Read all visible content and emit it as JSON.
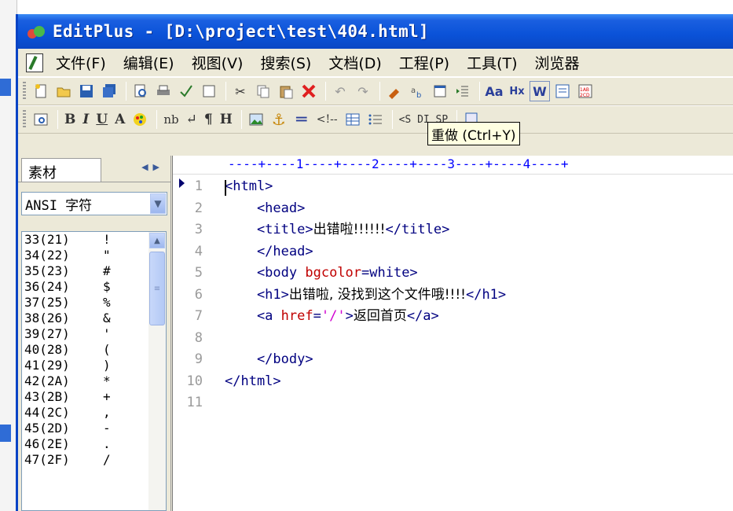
{
  "window": {
    "title": "EditPlus - [D:\\project\\test\\404.html]"
  },
  "menu": [
    "文件(F)",
    "编辑(E)",
    "视图(V)",
    "搜索(S)",
    "文档(D)",
    "工程(P)",
    "工具(T)",
    "浏览器"
  ],
  "toolbar2_text": {
    "bold": "B",
    "italic": "I",
    "underline": "U",
    "font": "A",
    "nb": "nb",
    "newline": "↵",
    "para": "¶",
    "heading": "H",
    "comment": "<!--",
    "sdisp": "<S DI SP"
  },
  "tooltip": "重做 (Ctrl+Y)",
  "left_panel": {
    "tab_label": "素材",
    "charset": "ANSI 字符",
    "chars": [
      {
        "code": "33(21)",
        "glyph": "!"
      },
      {
        "code": "34(22)",
        "glyph": "\""
      },
      {
        "code": "35(23)",
        "glyph": "#"
      },
      {
        "code": "36(24)",
        "glyph": "$"
      },
      {
        "code": "37(25)",
        "glyph": "%"
      },
      {
        "code": "38(26)",
        "glyph": "&"
      },
      {
        "code": "39(27)",
        "glyph": "'"
      },
      {
        "code": "40(28)",
        "glyph": "("
      },
      {
        "code": "41(29)",
        "glyph": ")"
      },
      {
        "code": "42(2A)",
        "glyph": "*"
      },
      {
        "code": "43(2B)",
        "glyph": "+"
      },
      {
        "code": "44(2C)",
        "glyph": ","
      },
      {
        "code": "45(2D)",
        "glyph": "-"
      },
      {
        "code": "46(2E)",
        "glyph": "."
      },
      {
        "code": "47(2F)",
        "glyph": "/"
      }
    ]
  },
  "editor": {
    "ruler": "----+----1----+----2----+----3----+----4----+",
    "lines": [
      {
        "n": "1",
        "parts": [
          [
            "tag",
            "<html>"
          ]
        ]
      },
      {
        "n": "2",
        "parts": [
          [
            "tag",
            "    <head>"
          ]
        ]
      },
      {
        "n": "3",
        "parts": [
          [
            "tag",
            "    <title>"
          ],
          [
            "txt",
            "出错啦!!!!!!"
          ],
          [
            "tag",
            "</title>"
          ]
        ]
      },
      {
        "n": "4",
        "parts": [
          [
            "tag",
            "    </head>"
          ]
        ]
      },
      {
        "n": "5",
        "parts": [
          [
            "tag",
            "    <body "
          ],
          [
            "attr",
            "bgcolor"
          ],
          [
            "tag",
            "=white>"
          ]
        ]
      },
      {
        "n": "6",
        "parts": [
          [
            "tag",
            "    <h1>"
          ],
          [
            "txt",
            "出错啦, 没找到这个文件哦!!!!"
          ],
          [
            "tag",
            "</h1>"
          ]
        ]
      },
      {
        "n": "7",
        "parts": [
          [
            "tag",
            "    <a "
          ],
          [
            "attr",
            "href"
          ],
          [
            "tag",
            "="
          ],
          [
            "val",
            "'/'"
          ],
          [
            "tag",
            ">"
          ],
          [
            "txt",
            "返回首页"
          ],
          [
            "tag",
            "</a>"
          ]
        ]
      },
      {
        "n": "8",
        "parts": []
      },
      {
        "n": "9",
        "parts": [
          [
            "tag",
            "    </body>"
          ]
        ]
      },
      {
        "n": "10",
        "parts": [
          [
            "tag",
            "</html>"
          ]
        ]
      },
      {
        "n": "11",
        "parts": []
      }
    ]
  }
}
